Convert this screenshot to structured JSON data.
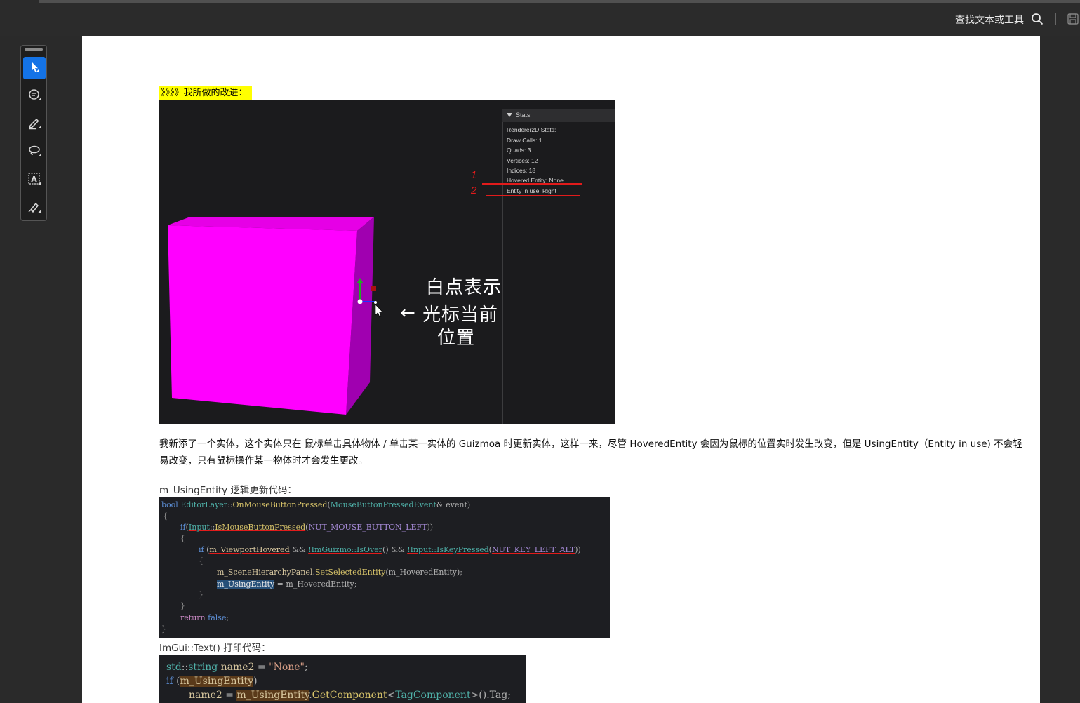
{
  "topbar": {
    "search_label": "查找文本或工具",
    "icons": [
      "search-icon",
      "save-icon"
    ]
  },
  "toolbar": {
    "tools": [
      {
        "name": "select-tool",
        "icon": "cursor-arrow-icon",
        "active": true
      },
      {
        "name": "comment-tool",
        "icon": "comment-bubble-icon",
        "active": false
      },
      {
        "name": "highlight-tool",
        "icon": "pen-icon",
        "active": false
      },
      {
        "name": "lasso-tool",
        "icon": "lasso-icon",
        "active": false
      },
      {
        "name": "text-select-tool",
        "icon": "text-box-icon",
        "active": false
      },
      {
        "name": "sign-tool",
        "icon": "signature-pen-icon",
        "active": false
      }
    ],
    "accent": "#1473e6"
  },
  "document": {
    "highlight_heading": "》》》》我所做的改进：",
    "screenshot": {
      "panel_title": "Stats",
      "stats": [
        "Renderer2D Stats:",
        "Draw Calls: 1",
        "Quads: 3",
        "Vertices: 12",
        "Indices: 18",
        "Hovered Entity: None",
        "Entity in use: Right"
      ],
      "annotation_numbers": [
        "1",
        "2"
      ],
      "handwritten_note": [
        "白点表示",
        "光标当前",
        "位置"
      ],
      "arrow_glyph": "←",
      "cube_color": "#ff00ff"
    },
    "paragraph": "我新添了一个实体，这个实体只在 鼠标单击具体物体 / 单击某一实体的 Guizmoa 时更新实体，这样一来，尽管 HoveredEntity 会因为鼠标的位置实时发生改变，但是 UsingEntity（Entity in use) 不会轻易改变，只有鼠标操作某一物体时才会发生更改。",
    "caption_using_entity": "m_UsingEntity 逻辑更新代码：",
    "code_block_1": [
      "bool EditorLayer::OnMouseButtonPressed(MouseButtonPressedEvent& event)",
      "{",
      "    if(Input::IsMouseButtonPressed(NUT_MOUSE_BUTTON_LEFT))",
      "    {",
      "        if (m_ViewportHovered && !ImGuizmo::IsOver() && !Input::IsKeyPressed(NUT_KEY_LEFT_ALT))",
      "        {",
      "            m_SceneHierarchyPanel.SetSelectedEntity(m_HoveredEntity);",
      "            m_UsingEntity = m_HoveredEntity;",
      "        }",
      "    }",
      "    return false;",
      "}"
    ],
    "caption_imgui": "ImGui::Text() 打印代码：",
    "code_block_2": [
      "std::string name2 = \"None\";",
      "if (m_UsingEntity)",
      "    name2 = m_UsingEntity.GetComponent<TagComponent>().Tag;"
    ]
  }
}
